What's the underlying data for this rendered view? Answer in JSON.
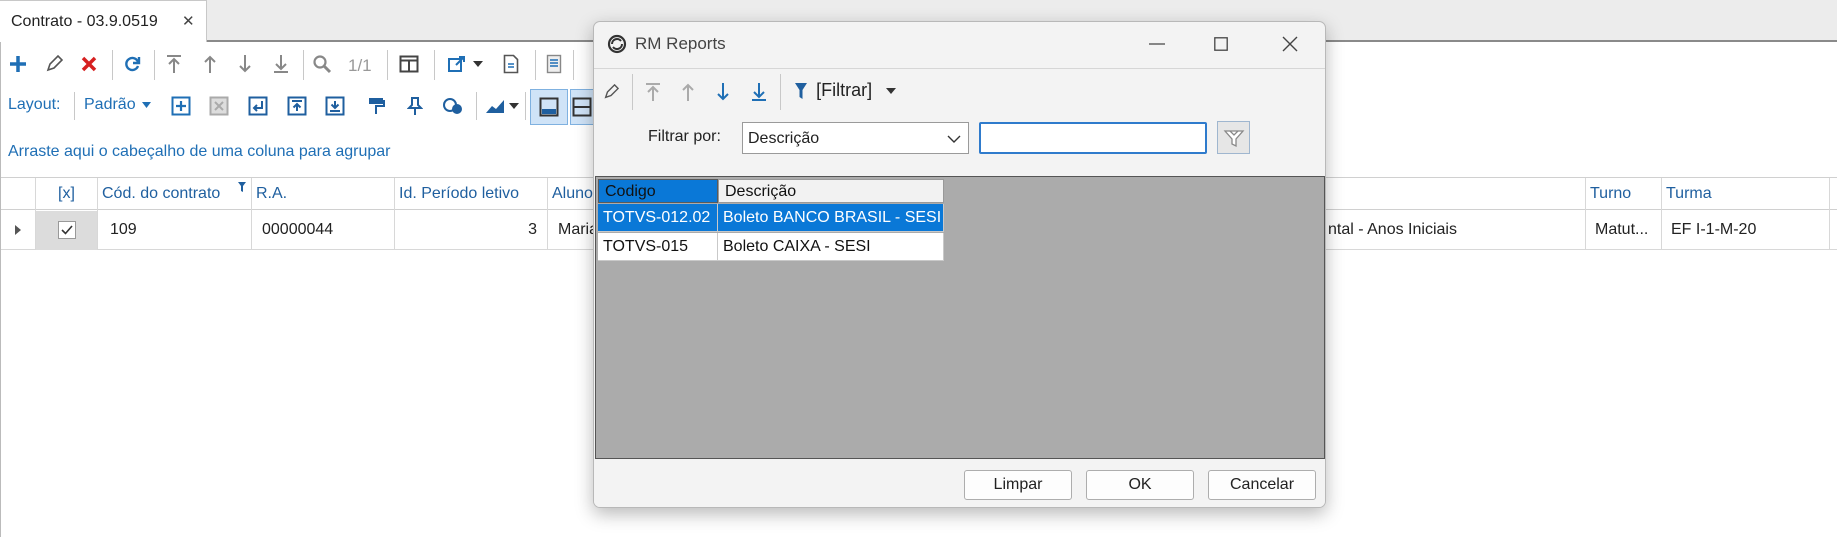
{
  "tab": {
    "title": "Contrato - 03.9.0519",
    "close": "✕"
  },
  "toolbar": {
    "record_counter": "1/1"
  },
  "layout_bar": {
    "label": "Layout:",
    "value": "Padrão"
  },
  "grid": {
    "group_hint": "Arraste aqui o cabeçalho de uma coluna para agrupar",
    "columns": [
      "[x]",
      "Cód. do contrato",
      "R.A.",
      "Id. Período letivo",
      "Aluno",
      "Turno",
      "Turma"
    ],
    "row": {
      "codigo": "109",
      "ra": "00000044",
      "periodo": "3",
      "aluno": "Maria",
      "curso": "ntal - Anos Iniciais",
      "turno": "Matut...",
      "turma": "EF I-1-M-20"
    }
  },
  "dialog": {
    "title": "RM Reports",
    "filter_menu": "[Filtrar]",
    "filter_label": "Filtrar por:",
    "filter_field": "Descrição",
    "filter_text": "",
    "lookup": {
      "columns": [
        "Codigo",
        "Descrição"
      ],
      "rows": [
        {
          "codigo": "TOTVS-012.02",
          "descricao": "Boleto BANCO BRASIL - SESI"
        },
        {
          "codigo": "TOTVS-015",
          "descricao": "Boleto CAIXA - SESI"
        }
      ]
    },
    "buttons": {
      "clear": "Limpar",
      "ok": "OK",
      "cancel": "Cancelar"
    }
  },
  "colors": {
    "accent": "#1f6fb5",
    "selection": "#0a78d7",
    "lookup_bg": "#ababab",
    "delete": "#d62020"
  }
}
